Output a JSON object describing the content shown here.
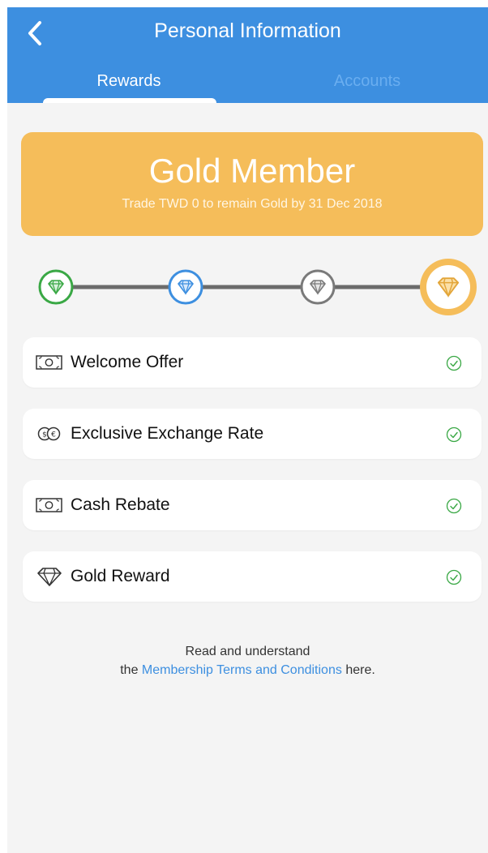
{
  "header": {
    "title": "Personal Information",
    "tabs": [
      {
        "label": "Rewards",
        "active": true
      },
      {
        "label": "Accounts",
        "active": false
      }
    ]
  },
  "membership": {
    "level": "Gold Member",
    "subtitle": "Trade TWD 0 to remain Gold by 31 Dec 2018"
  },
  "tiers": [
    {
      "icon": "green-diamond-icon",
      "color": "#3aa845"
    },
    {
      "icon": "blue-diamond-icon",
      "color": "#3d8fe0"
    },
    {
      "icon": "gray-diamond-icon",
      "color": "#7a7a7a"
    },
    {
      "icon": "gold-diamond-icon",
      "color": "#f5bd5a",
      "current": true
    }
  ],
  "benefits": [
    {
      "label": "Welcome Offer",
      "icon": "banknote-icon"
    },
    {
      "label": "Exclusive Exchange Rate",
      "icon": "currency-exchange-icon"
    },
    {
      "label": "Cash Rebate",
      "icon": "banknote-icon"
    },
    {
      "label": "Gold Reward",
      "icon": "diamond-icon"
    }
  ],
  "footer": {
    "line1": "Read and understand",
    "prefix": "the",
    "link": "Membership Terms and Conditions",
    "suffix": "here."
  },
  "colors": {
    "header": "#3d8fe0",
    "gold": "#f5bd5a",
    "check": "#3aa845",
    "link": "#3d8fe0"
  }
}
